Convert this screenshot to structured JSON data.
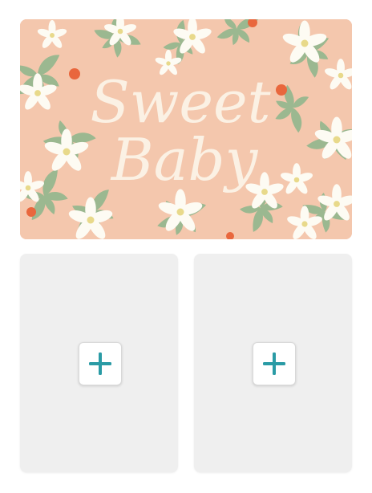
{
  "hero_card": {
    "line1": "Sweet",
    "line2": "Baby",
    "background_color": "#f4c7ad",
    "text_color": "#fbf1e4",
    "leaf_color": "#9bb890",
    "flower_color": "#fdfbf3",
    "berry_color": "#e9673d"
  },
  "photo_slots": [
    {
      "icon": "plus-icon",
      "accent": "#2a9ba5"
    },
    {
      "icon": "plus-icon",
      "accent": "#2a9ba5"
    }
  ]
}
